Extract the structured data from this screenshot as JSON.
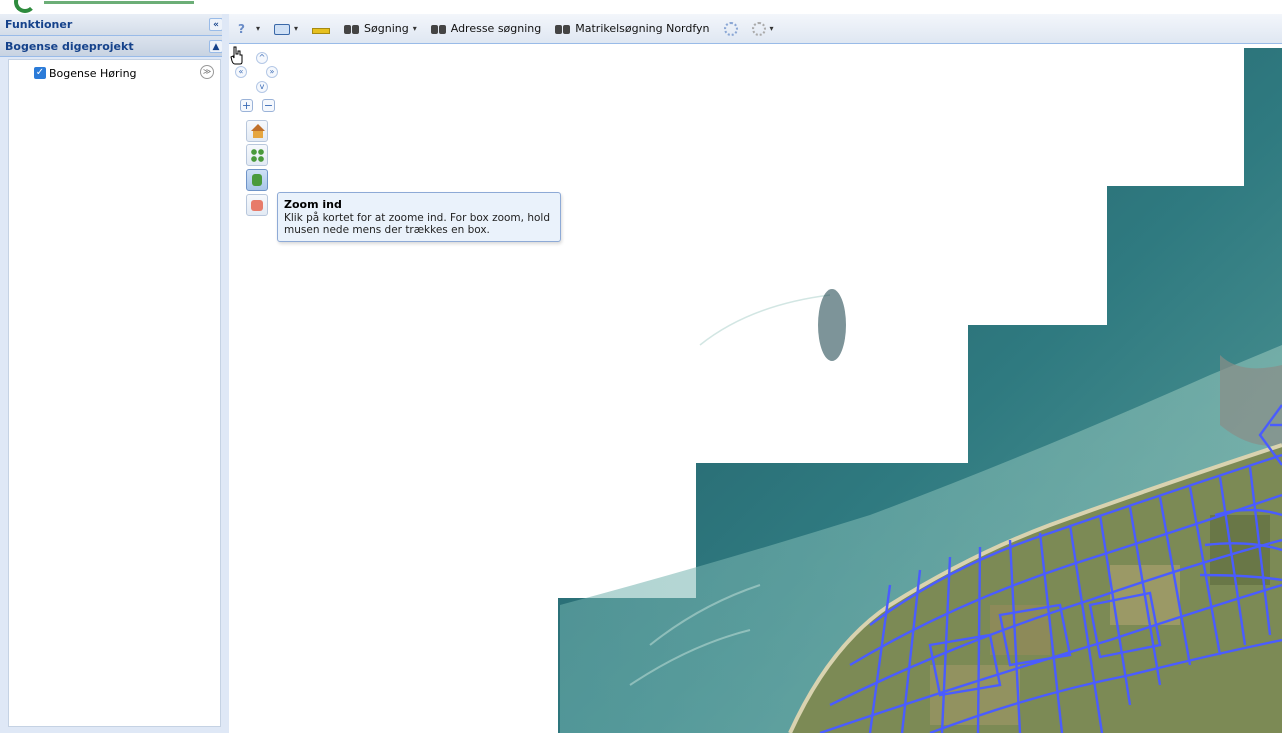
{
  "left_panel": {
    "title": "Funktioner",
    "collapse_glyph": "«",
    "section_title": "Bogense digeprojekt",
    "section_collapse_glyph": "▲",
    "layers": [
      {
        "label": "Bogense Høring",
        "checked": true,
        "check_glyph": "✓",
        "options_glyph": "≫"
      }
    ]
  },
  "toolbar": {
    "help_glyph": "?",
    "search_label": "Søgning",
    "address_search_label": "Adresse søgning",
    "cadastre_search_label": "Matrikelsøgning Nordfyn",
    "caret_glyph": "▾"
  },
  "map_nav": {
    "pan_up": "^",
    "pan_left": "«",
    "pan_right": "»",
    "pan_down": "v",
    "zoom_in": "+",
    "zoom_out": "−"
  },
  "tooltip": {
    "title": "Zoom ind",
    "body": "Klik på kortet for at zoome ind. For box zoom, hold musen nede mens der trækkes en box."
  },
  "colors": {
    "panel_bg": "#dfe8f6",
    "header_text": "#15428b",
    "parcel_lines": "#4a5cff",
    "sea": "#2d6f78",
    "land": "#7c8a55"
  }
}
